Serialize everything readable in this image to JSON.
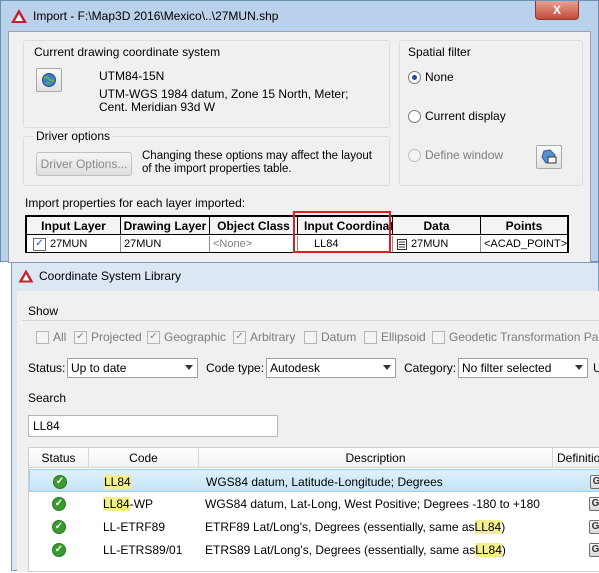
{
  "import_window": {
    "title": "Import - F:\\Map3D 2016\\Mexico\\..\\27MUN.shp",
    "close_label": "X",
    "current_cs": {
      "group_label": "Current drawing coordinate system",
      "code": "UTM84-15N",
      "description": "UTM-WGS 1984 datum, Zone 15 North, Meter; Cent. Meridian 93d W"
    },
    "driver_options": {
      "group_label": "Driver options",
      "button_label": "Driver Options...",
      "note": "Changing these options may affect the layout of the import properties table."
    },
    "spatial_filter": {
      "group_label": "Spatial filter",
      "options": [
        {
          "label": "None",
          "selected": true,
          "enabled": true
        },
        {
          "label": "Current display",
          "selected": false,
          "enabled": true
        },
        {
          "label": "Define window",
          "selected": false,
          "enabled": false
        }
      ]
    },
    "layer_table": {
      "caption": "Import properties for each layer imported:",
      "headers": [
        "Input Layer",
        "Drawing Layer",
        "Object Class",
        "Input Coordinat",
        "Data",
        "Points"
      ],
      "row": {
        "input_layer": "27MUN",
        "checked": true,
        "drawing_layer": "27MUN",
        "object_class": "<None>",
        "input_coordinate": "LL84",
        "data": "27MUN",
        "points": "<ACAD_POINT>"
      }
    }
  },
  "csl_window": {
    "title": "Coordinate System Library",
    "show": {
      "label": "Show",
      "checkboxes": [
        {
          "label": "All",
          "checked": false
        },
        {
          "label": "Projected",
          "checked": true
        },
        {
          "label": "Geographic",
          "checked": true
        },
        {
          "label": "Arbitrary",
          "checked": true
        },
        {
          "label": "Datum",
          "checked": false
        },
        {
          "label": "Ellipsoid",
          "checked": false
        },
        {
          "label": "Geodetic Transformation Pat",
          "checked": false
        }
      ]
    },
    "filters": {
      "status_label": "Status:",
      "status_value": "Up to date",
      "code_type_label": "Code type:",
      "code_type_value": "Autodesk",
      "category_label": "Category:",
      "category_value": "No filter selected",
      "extra_label": "U"
    },
    "search": {
      "label": "Search",
      "value": "LL84"
    },
    "grid": {
      "headers": [
        "Status",
        "Code",
        "Description",
        "Definition t"
      ],
      "rows": [
        {
          "code_hl": "LL84",
          "code_rest": "",
          "desc_pre": "WGS84 datum, Latitude-Longitude; Degrees",
          "desc_hl": "",
          "desc_post": "",
          "def": "G",
          "selected": true
        },
        {
          "code_hl": "LL84",
          "code_rest": "-WP",
          "desc_pre": "WGS84 datum, Lat-Long, West Positive; Degrees -180 to +180",
          "desc_hl": "",
          "desc_post": "",
          "def": "G",
          "selected": false
        },
        {
          "code_hl": "",
          "code_rest": "LL-ETRF89",
          "desc_pre": "ETRF89 Lat/Long's, Degrees (essentially, same as ",
          "desc_hl": "LL84",
          "desc_post": ")",
          "def": "G",
          "selected": false
        },
        {
          "code_hl": "",
          "code_rest": "LL-ETRS89/01",
          "desc_pre": "ETRS89 Lat/Long's, Degrees (essentially, same as ",
          "desc_hl": "LL84",
          "desc_post": ")",
          "def": "G",
          "selected": false
        }
      ]
    }
  },
  "colors": {
    "highlight_box": "#e02020",
    "code_highlight": "#f3ef8e",
    "selected_row": "#cde8f7"
  }
}
